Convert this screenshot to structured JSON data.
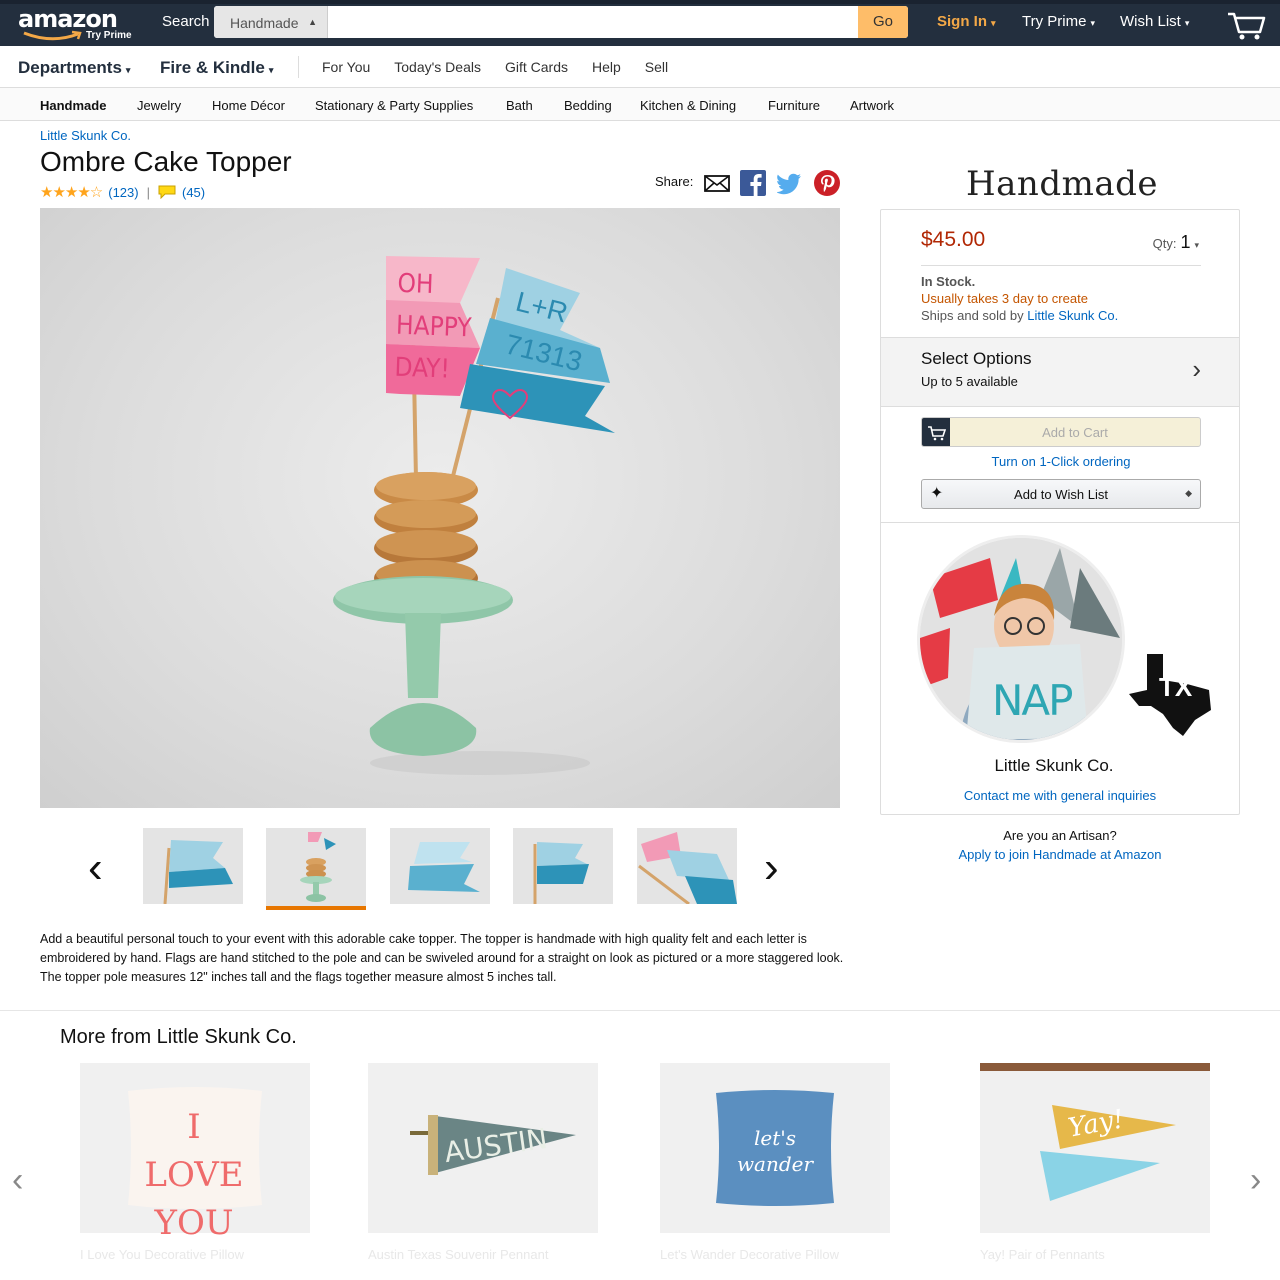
{
  "header": {
    "logo_text": "amazon",
    "logo_sub": "Try Prime",
    "search_label": "Search",
    "search_category": "Handmade",
    "search_value": "",
    "search_button": "Go",
    "sign_in": "Sign In",
    "try_prime": "Try Prime",
    "wish_list": "Wish List"
  },
  "dept_bar": {
    "departments": "Departments",
    "fire_kindle": "Fire & Kindle",
    "links": [
      "For You",
      "Today's Deals",
      "Gift Cards",
      "Help",
      "Sell"
    ]
  },
  "categories": [
    "Handmade",
    "Jewelry",
    "Home Décor",
    "Stationary & Party Supplies",
    "Bath",
    "Bedding",
    "Kitchen & Dining",
    "Furniture",
    "Artwork"
  ],
  "product": {
    "seller": "Little Skunk Co.",
    "title": "Ombre Cake Topper",
    "stars": "★★★★☆",
    "rating_count": "(123)",
    "comment_count": "(45)",
    "share_label": "Share:",
    "main_image_flag1": [
      "OH",
      "HAPPY",
      "DAY!"
    ],
    "main_image_flag2": [
      "L+R",
      "71313"
    ],
    "description": "Add a beautiful personal touch to your event with this adorable cake topper. The topper is handmade with high quality felt and each letter is embroidered by hand. Flags are hand stitched to the pole and can be swiveled around for a straight on look as pictured or a more staggered look. The topper pole measures 12\" inches tall and the flags together measure almost 5 inches tall."
  },
  "buybox": {
    "brand_logo": "Handmade",
    "price": "$45.00",
    "qty_label": "Qty:",
    "qty_value": "1",
    "stock": "In Stock.",
    "takes": "Usually takes 3 day to create",
    "ships_prefix": "Ships and sold by ",
    "ships_seller": "Little Skunk Co.",
    "options_title": "Select Options",
    "options_sub": "Up to 5 available",
    "add_to_cart": "Add to Cart",
    "one_click": "Turn on 1-Click ordering",
    "add_to_wish": "Add to Wish List",
    "artisan_name": "Little Skunk Co.",
    "contact": "Contact me with general inquiries",
    "state_label": "TX"
  },
  "artisan": {
    "question": "Are you an Artisan?",
    "apply": "Apply to join Handmade at Amazon"
  },
  "more_from": {
    "title": "More from Little Skunk Co.",
    "items": [
      {
        "label": "I Love You Decorative Pillow",
        "art": "I LOVE YOU"
      },
      {
        "label": "Austin Texas Souvenir Pennant",
        "art": "AUSTIN"
      },
      {
        "label": "Let's Wander Decorative Pillow",
        "art": "let's wander"
      },
      {
        "label": "Yay! Pair of Pennants",
        "art": "Yay!"
      }
    ]
  },
  "colors": {
    "nav_bg": "#232f3e",
    "go_button": "#febd69",
    "sign_in": "#f3a847",
    "price": "#b12704",
    "link": "#0066c0",
    "takes": "#c45500",
    "thumb_active": "#e77600"
  },
  "icons": [
    "cart-icon",
    "mail-icon",
    "facebook-icon",
    "twitter-icon",
    "pinterest-icon",
    "chevron-left-icon",
    "chevron-right-icon",
    "sparkle-icon",
    "texas-icon"
  ]
}
